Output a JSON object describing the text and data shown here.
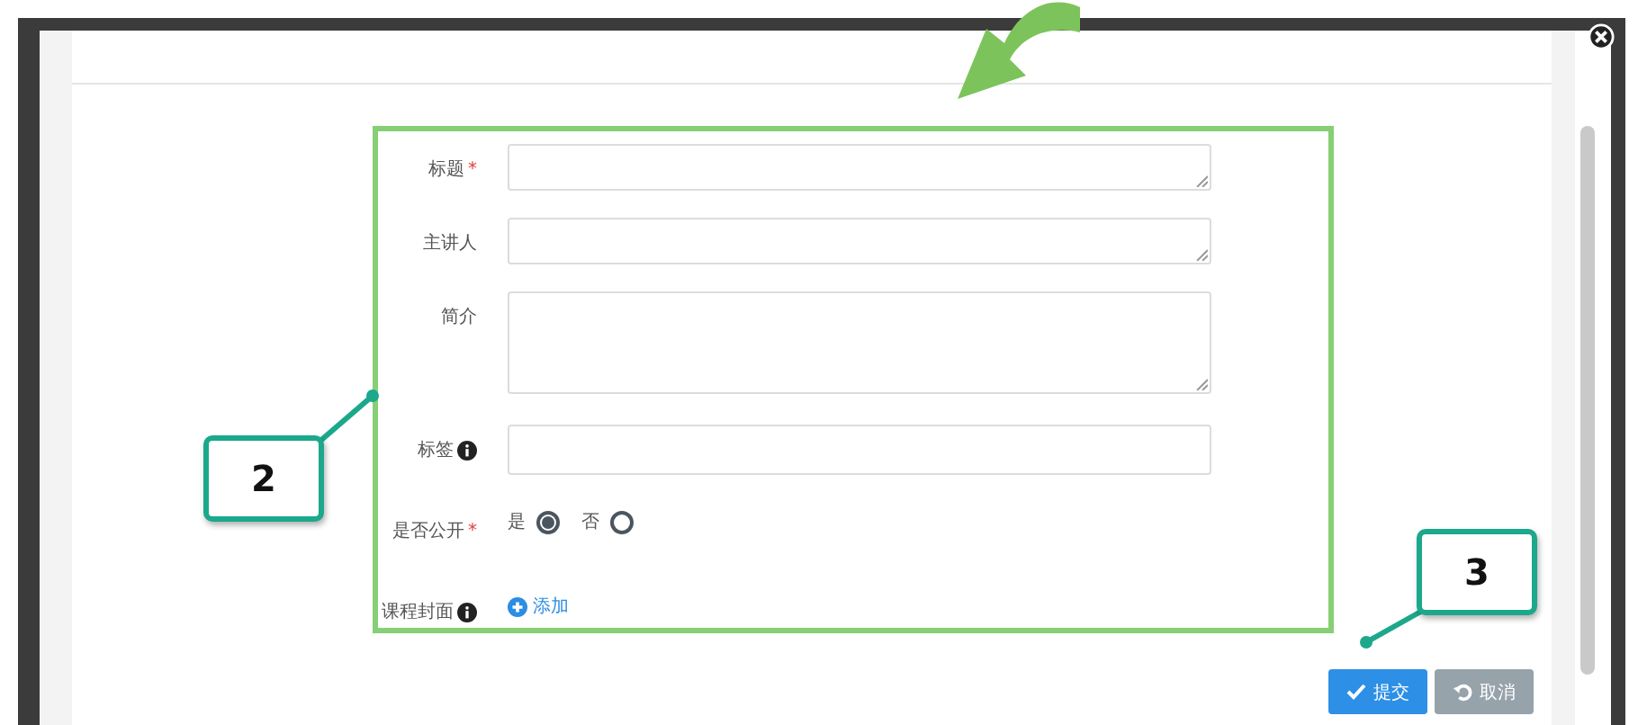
{
  "form": {
    "fields": [
      {
        "kind": "textarea",
        "label": "标题",
        "required_mark": "*",
        "info": false
      },
      {
        "kind": "textarea",
        "label": "主讲人",
        "info": false
      },
      {
        "kind": "tallarea",
        "label": "简介",
        "info": false
      },
      {
        "kind": "input",
        "label": "标签",
        "info": true
      },
      {
        "kind": "radio",
        "label": "是否公开",
        "required_mark": "*",
        "info": false,
        "options": [
          {
            "label": "是",
            "selected": true
          },
          {
            "label": "否",
            "selected": false
          }
        ]
      },
      {
        "kind": "add",
        "label": "课程封面",
        "info": true,
        "action": "添加"
      }
    ]
  },
  "buttons": [
    {
      "kind": "primary",
      "label": "提交"
    },
    {
      "kind": "secondary",
      "label": "取消"
    }
  ],
  "annotations": [
    {
      "kind": "left",
      "label": "2"
    },
    {
      "kind": "right",
      "label": "3"
    }
  ]
}
